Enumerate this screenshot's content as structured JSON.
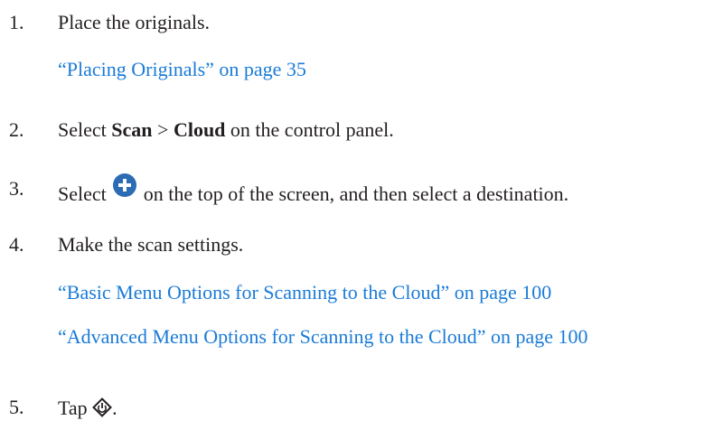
{
  "steps": [
    {
      "number": "1.",
      "text": "Place the originals.",
      "links": [
        "“Placing Originals” on page 35"
      ]
    },
    {
      "number": "2.",
      "prefix": "Select ",
      "bold1": "Scan",
      "separator": " > ",
      "bold2": "Cloud",
      "suffix": " on the control panel."
    },
    {
      "number": "3.",
      "prefix": "Select ",
      "icon": "plus-circle-icon",
      "suffix": " on the top of the screen, and then select a destination."
    },
    {
      "number": "4.",
      "text": "Make the scan settings.",
      "links": [
        "“Basic Menu Options for Scanning to the Cloud” on page 100",
        "“Advanced Menu Options for Scanning to the Cloud” on page 100"
      ]
    },
    {
      "number": "5.",
      "prefix": "Tap ",
      "icon": "start-diamond-icon",
      "suffix": "."
    }
  ],
  "colors": {
    "text": "#231f20",
    "link": "#1a7bd8",
    "icon": "#2b6cb5"
  }
}
